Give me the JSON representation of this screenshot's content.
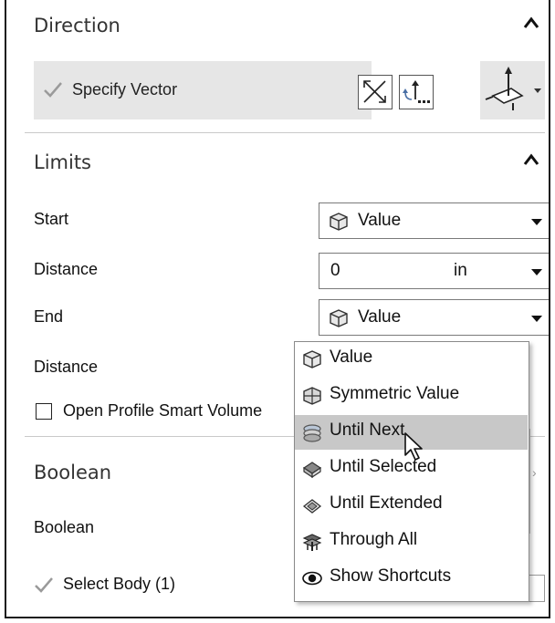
{
  "direction": {
    "title": "Direction",
    "specify_vector_label": "Specify Vector"
  },
  "limits": {
    "title": "Limits",
    "start_label": "Start",
    "start_value": "Value",
    "start_distance_label": "Distance",
    "start_distance_value": "0",
    "start_distance_unit": "in",
    "end_label": "End",
    "end_value": "Value",
    "end_distance_label": "Distance",
    "open_profile_label": "Open Profile Smart Volume",
    "open_profile_checked": false
  },
  "boolean": {
    "title": "Boolean",
    "boolean_label": "Boolean",
    "select_body_label": "Select Body (1)"
  },
  "end_dropdown": {
    "items": [
      {
        "label": "Value",
        "icon": "value-icon"
      },
      {
        "label": "Symmetric Value",
        "icon": "symmetric-value-icon"
      },
      {
        "label": "Until Next",
        "icon": "until-next-icon",
        "highlighted": true
      },
      {
        "label": "Until Selected",
        "icon": "until-selected-icon"
      },
      {
        "label": "Until Extended",
        "icon": "until-extended-icon"
      },
      {
        "label": "Through All",
        "icon": "through-all-icon"
      },
      {
        "label": "Show Shortcuts",
        "icon": "show-shortcuts-icon"
      }
    ]
  },
  "colors": {
    "panel_bg": "#ffffff",
    "row_highlight": "#e6e6e6",
    "menu_highlight": "#c8c8c8",
    "check_color": "#9a9a9a",
    "border": "#1a1a1a"
  }
}
